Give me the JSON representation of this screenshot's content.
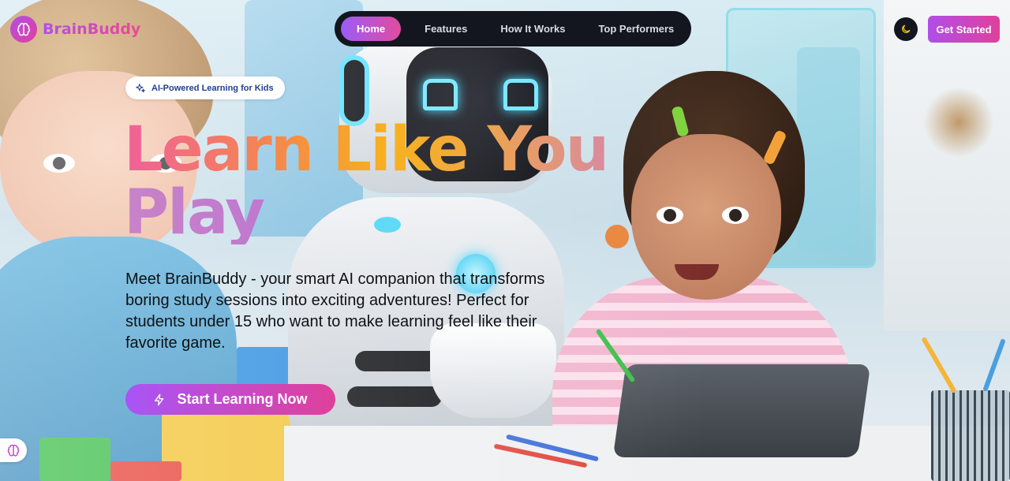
{
  "brand": {
    "name": "BrainBuddy"
  },
  "nav": {
    "items": [
      {
        "label": "Home",
        "active": true
      },
      {
        "label": "Features",
        "active": false
      },
      {
        "label": "How It Works",
        "active": false
      },
      {
        "label": "Top Performers",
        "active": false
      }
    ]
  },
  "header": {
    "theme_toggle_icon": "moon-icon",
    "cta_label": "Get Started"
  },
  "hero": {
    "badge": "AI-Powered Learning for Kids",
    "badge_icon": "sparkles-icon",
    "headline_line1": "Learn Like You",
    "headline_line2": "Play",
    "subtitle": "Meet BrainBuddy - your smart AI companion that transforms boring study sessions into exciting adventures! Perfect for students under 15 who want to make learning feel like their favorite game.",
    "cta_label": "Start Learning Now",
    "cta_icon": "lightning-icon"
  },
  "floating_widget": {
    "icon": "brain-icon"
  },
  "colors": {
    "accent_purple": "#a855f7",
    "accent_pink": "#e0409a",
    "nav_bg": "#13161f",
    "badge_text": "#1f3f8f"
  }
}
